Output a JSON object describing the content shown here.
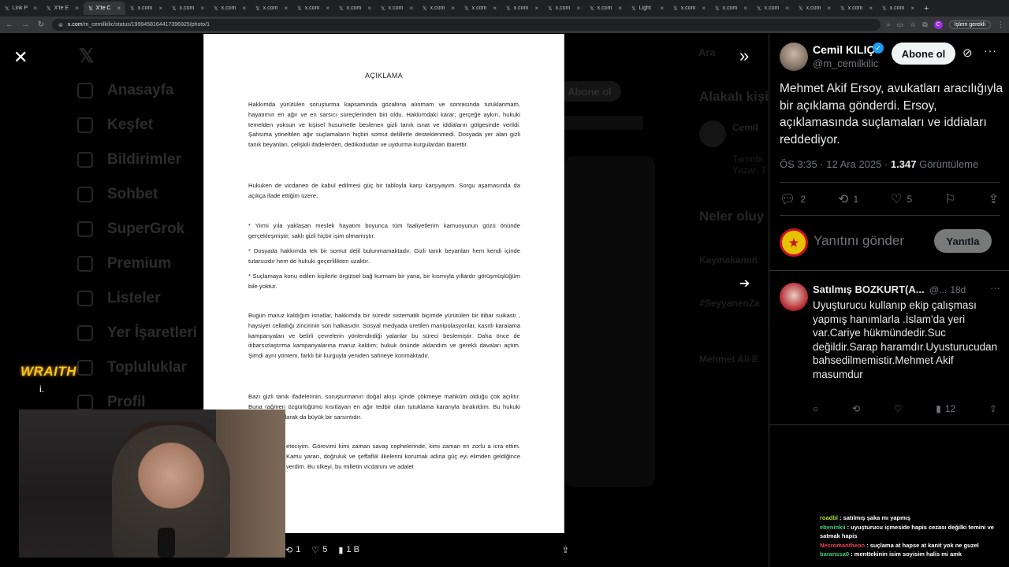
{
  "browser": {
    "tabs": [
      {
        "label": "Link P"
      },
      {
        "label": "X'te E"
      },
      {
        "label": "X'te C",
        "active": true
      },
      {
        "label": "x.com"
      },
      {
        "label": "x.com"
      },
      {
        "label": "x.com"
      },
      {
        "label": "x.com"
      },
      {
        "label": "x.com"
      },
      {
        "label": "x.com"
      },
      {
        "label": "x.com"
      },
      {
        "label": "x.com"
      },
      {
        "label": "x.com"
      },
      {
        "label": "x.com"
      },
      {
        "label": "x.com"
      },
      {
        "label": "x.com"
      },
      {
        "label": "Light"
      },
      {
        "label": "x.com"
      },
      {
        "label": "x.com"
      },
      {
        "label": "x.com"
      },
      {
        "label": "x.com"
      },
      {
        "label": "x.com"
      },
      {
        "label": "x.com"
      }
    ],
    "url_host": "x.com",
    "url_path": "/m_cemilkilic/status/1999458164417396925/photo/1",
    "update_label": "İşlem gerekli",
    "profile_letter": "C"
  },
  "background_nav": [
    "Anasayfa",
    "Keşfet",
    "Bildirimler",
    "Sohbet",
    "SuperGrok",
    "Premium",
    "Listeler",
    "Yer İşaretleri",
    "Topluluklar",
    "Profil"
  ],
  "background_right": {
    "follow": "Abone ol",
    "related": "Alakalı kişi",
    "trends_title": "Neler oluy",
    "trend1": "Kaymakamın",
    "trend2": "#SeyyanenZa",
    "trend3": "Mehmet Ali E"
  },
  "document": {
    "title": "AÇIKLAMA",
    "paragraphs": [
      "Hakkımda yürütülen soruşturma kapsamında gözaltına alınmam ve sonrasında tutuklanmam, hayatımın en ağır ve en sarsıcı süreçlerinden biri oldu. Hakkımdaki karar; gerçeğe aykırı, hukuki temelden yoksun ve kişisel husumetle beslenen gizli tanık isnat ve iddiaların gölgesinde verildi. Şahsıma yöneltilen ağır suçlamaların hiçbiri somut delillerle desteklenmedi. Dosyada yer alan gizli tanık beyanları, çelişkili ifadelerden, dedikodudan ve uydurma kurgulardan ibarettir.",
      "Hukuken de vicdanen de kabul edilmesi güç bir tabloyla karşı karşıyayım. Sorgu aşamasında da açıkça ifade ettiğim üzere;",
      "* Yirmi yıla yaklaşan meslek hayatım boyunca tüm faaliyetlerim kamuoyunun gözü önünde gerçekleşmiştir; saklı gizli hiçbir işim olmamıştır.",
      "* Dosyada hakkımda tek bir somut delil bulunmamaktadır. Gizli tanık beyanları hem kendi içinde tutarsızdır hem de hukuki geçerlilikten uzaktır.",
      "* Suçlamaya konu edilen kişilerle örgütsel bağ kurmam bir yana, bir kısmıyla yıllardır görüşmüşlüğüm bile yoktur.",
      "Bugün maruz kaldığım isnatlar, hakkımda bir süredir sistematik biçimde yürütülen bir itibar suikastı , haysiyet cellatlığı zincirinin son halkasıdır. Sosyal medyada üretilen manipülasyonlar, kasıtlı karalama kampanyaları ve belirli çevrelerin yönlendirdiği yalanlar bu süreci beslemiştir. Daha önce de itibarsızlaştırma kampanyalarına maruz kaldım; hukuk önünde aklandım ve gerekli davaları açtım. Şimdi aynı yöntem, farklı bir kurguyla yeniden sahneye konmaktadır.",
      "Bazı gizli tanık ifadelerinin, soruşturmanın doğal akışı içinde çökmeye mahkûm olduğu çok açıktır. Buna rağmen özgürlüğümü kısıtlayan en ağır tedbir olan tutuklama kararıyla bırakıldım. Bu hukuki değil, insani olarak da büyük bir sarsıntıdır.",
      "eteciyim. Görevimi kimi zaman savaş cephelerinde, kimi zaman en zorlu a icra ettim. Kamu yararı, doğruluk ve şeffaflık ilkelerini korumak adına güç eyi elimden geldiğince verdim. Bu ülkeyi, bu milletin vicdanını ve adalet"
    ]
  },
  "photo_actions": {
    "retweets": "1",
    "likes": "5",
    "views": "1 B"
  },
  "tweet": {
    "author_name": "Cemil KILIÇ",
    "author_handle": "@m_cemilkilic",
    "follow_label": "Abone ol",
    "text": "Mehmet Akif Ersoy, avukatları aracılığıyla bir açıklama gönderdi. Ersoy, açıklamasında suçlamaları ve iddiaları reddediyor.",
    "time": "ÖS 3:35 · 12 Ara 2025 · ",
    "views": "1.347",
    "views_label": " Görüntüleme",
    "replies": "2",
    "retweets": "1",
    "likes": "5"
  },
  "reply_box": {
    "placeholder": "Yanıtını gönder",
    "button": "Yanıtla"
  },
  "reply": {
    "name": "Satılmış BOZKURT(A...",
    "handle": "@...",
    "time": "· 18d",
    "text": "Uyuşturucu kullanıp ekip çalışması yapmış hanımlarla .İslam'da yeri var.Cariye hükmündedir.Suc değildir.Sarap haramdır.Uyusturucudan bahsedilmemistir.Mehmet Akif masumdur",
    "views": "12"
  },
  "overlay": {
    "brand": "WRAITH",
    "brand_sub": "i."
  },
  "chat": [
    {
      "user": "roadbl",
      "msg": " : satılmış şaka mı yapmış",
      "color": "#a6e22e"
    },
    {
      "user": "ebeninkii",
      "msg": " : uyuşturucu içmeside hapis cezası değilki temini ve",
      "color": "#3ed17a"
    },
    {
      "user": "",
      "msg": "satmak hapis",
      "color": "#ffffff"
    },
    {
      "user": "Necromantheon",
      "msg": " : suçlama at hapse at kanit yok ne guzel",
      "color": "#e8474f"
    },
    {
      "user": "baranssa0",
      "msg": " : menttekinin isim soyisim halis mi amk",
      "color": "#3ed17a"
    }
  ],
  "colors": {
    "accent": "#1d9bf0",
    "bg": "#000000",
    "text": "#e7e9ea",
    "muted": "#71767b"
  }
}
